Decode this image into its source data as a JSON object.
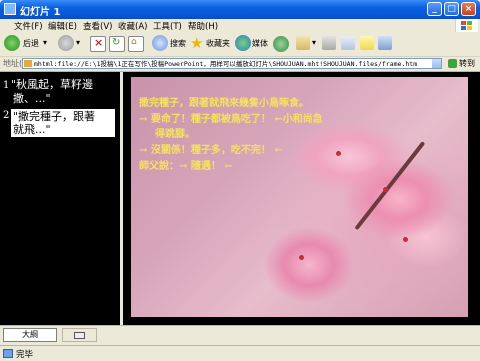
{
  "window": {
    "title": "幻灯片 1"
  },
  "menu": [
    "文件(F)",
    "编辑(E)",
    "查看(V)",
    "收藏(A)",
    "工具(T)",
    "帮助(H)"
  ],
  "toolbar": {
    "back_label": "后退",
    "search_label": "搜索",
    "favorites_label": "收藏夹",
    "media_label": "媒体"
  },
  "address": {
    "label": "地址(D)",
    "url": "mhtml:file://E:\\1投稿\\1正在写作\\投稿PowerPoint，用样可以播放幻灯片\\SHOUJUAN.mht!SHOUJUAN.files/frame.htm",
    "go_label": "转到"
  },
  "outline": {
    "items": [
      {
        "number": "1",
        "text_line1": "\"秋風起，草籽邊",
        "text_line2": "撒、...\""
      },
      {
        "number": "2",
        "text_line1": "\"撒完種子，跟著",
        "text_line2": "就飛...\""
      }
    ]
  },
  "slide": {
    "lines": [
      "撒完種子，跟著就飛來幾隻小鳥啄食。",
      "→ 要命了！種子都被鳥吃了！ ←小和尚急",
      "得跳腳。",
      "→ 沒關係！種子多，吃不完！ ←",
      "師父說：→ 隨遇！ ←"
    ]
  },
  "bottom": {
    "outline_tab": "大綱"
  },
  "status": {
    "text": "完毕"
  },
  "colors": {
    "titlebar": "#0a5fe0",
    "slide_text": "#f5e25c",
    "outline_bg": "#000000"
  }
}
